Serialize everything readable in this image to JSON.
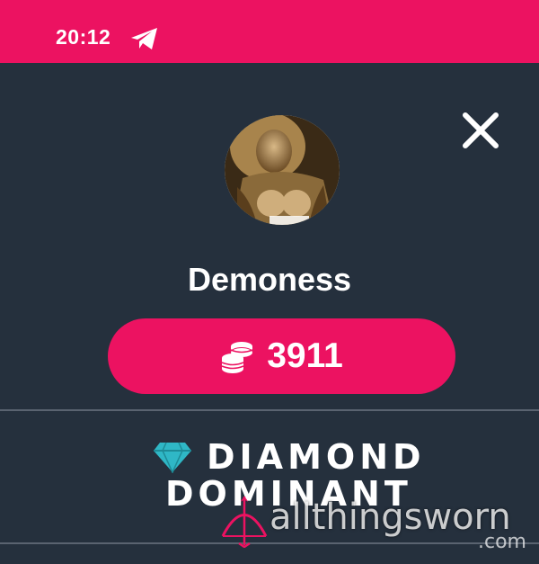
{
  "status_bar": {
    "time": "20:12",
    "background_color": "#ec1261",
    "icons": [
      "telegram-icon"
    ]
  },
  "close": {
    "icon": "close-icon"
  },
  "profile": {
    "username": "Demoness",
    "avatar_icon": "avatar"
  },
  "coins": {
    "icon": "coin-stack-icon",
    "value": "3911",
    "button_color": "#ec1261"
  },
  "rank": {
    "icon": "diamond-icon",
    "line1": "DIAMOND",
    "line2": "DOMINANT",
    "icon_color": "#2fb7c6"
  },
  "watermark": {
    "logo_icon": "cupid-bow-arrow-icon",
    "text": "allthingsworn",
    "tld": ".com",
    "logo_color": "#ec1261"
  },
  "colors": {
    "background": "#25303d",
    "accent": "#ec1261",
    "divider": "#5a6370"
  }
}
